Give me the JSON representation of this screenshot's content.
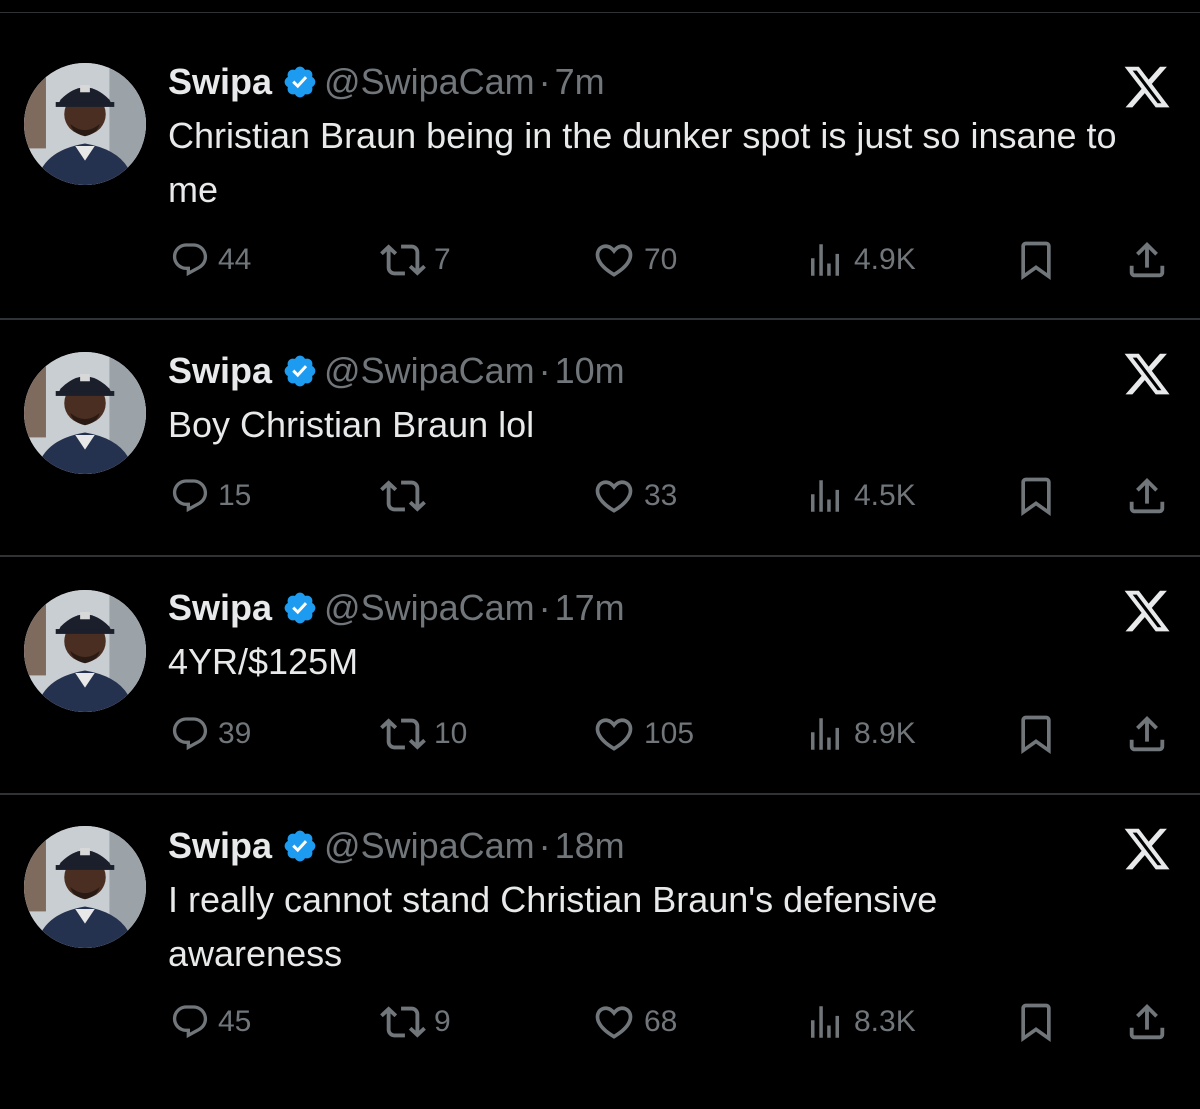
{
  "tweets": [
    {
      "author_name": "Swipa",
      "handle": "@SwipaCam",
      "separator": "·",
      "time": "7m",
      "text": "Christian Braun being in the dunker spot is just so insane to me",
      "replies": "44",
      "reposts": "7",
      "likes": "70",
      "views": "4.9K"
    },
    {
      "author_name": "Swipa",
      "handle": "@SwipaCam",
      "separator": "·",
      "time": "10m",
      "text": "Boy Christian Braun lol",
      "replies": "15",
      "reposts": "",
      "likes": "33",
      "views": "4.5K"
    },
    {
      "author_name": "Swipa",
      "handle": "@SwipaCam",
      "separator": "·",
      "time": "17m",
      "text": "4YR/$125M",
      "replies": "39",
      "reposts": "10",
      "likes": "105",
      "views": "8.9K"
    },
    {
      "author_name": "Swipa",
      "handle": "@SwipaCam",
      "separator": "·",
      "time": "18m",
      "text": "I really cannot stand Christian Braun's defensive awareness",
      "replies": "45",
      "reposts": "9",
      "likes": "68",
      "views": "8.3K"
    }
  ],
  "icons": {
    "reply": "reply-icon",
    "repost": "repost-icon",
    "like": "heart-icon",
    "views": "views-chart-icon",
    "bookmark": "bookmark-icon",
    "share": "share-icon",
    "verified": "verified-badge-icon",
    "brand": "x-logo-icon"
  },
  "colors": {
    "background": "#000000",
    "text": "#e7e9ea",
    "muted": "#71767b",
    "verified": "#1d9bf0",
    "divider": "#2f3336"
  }
}
